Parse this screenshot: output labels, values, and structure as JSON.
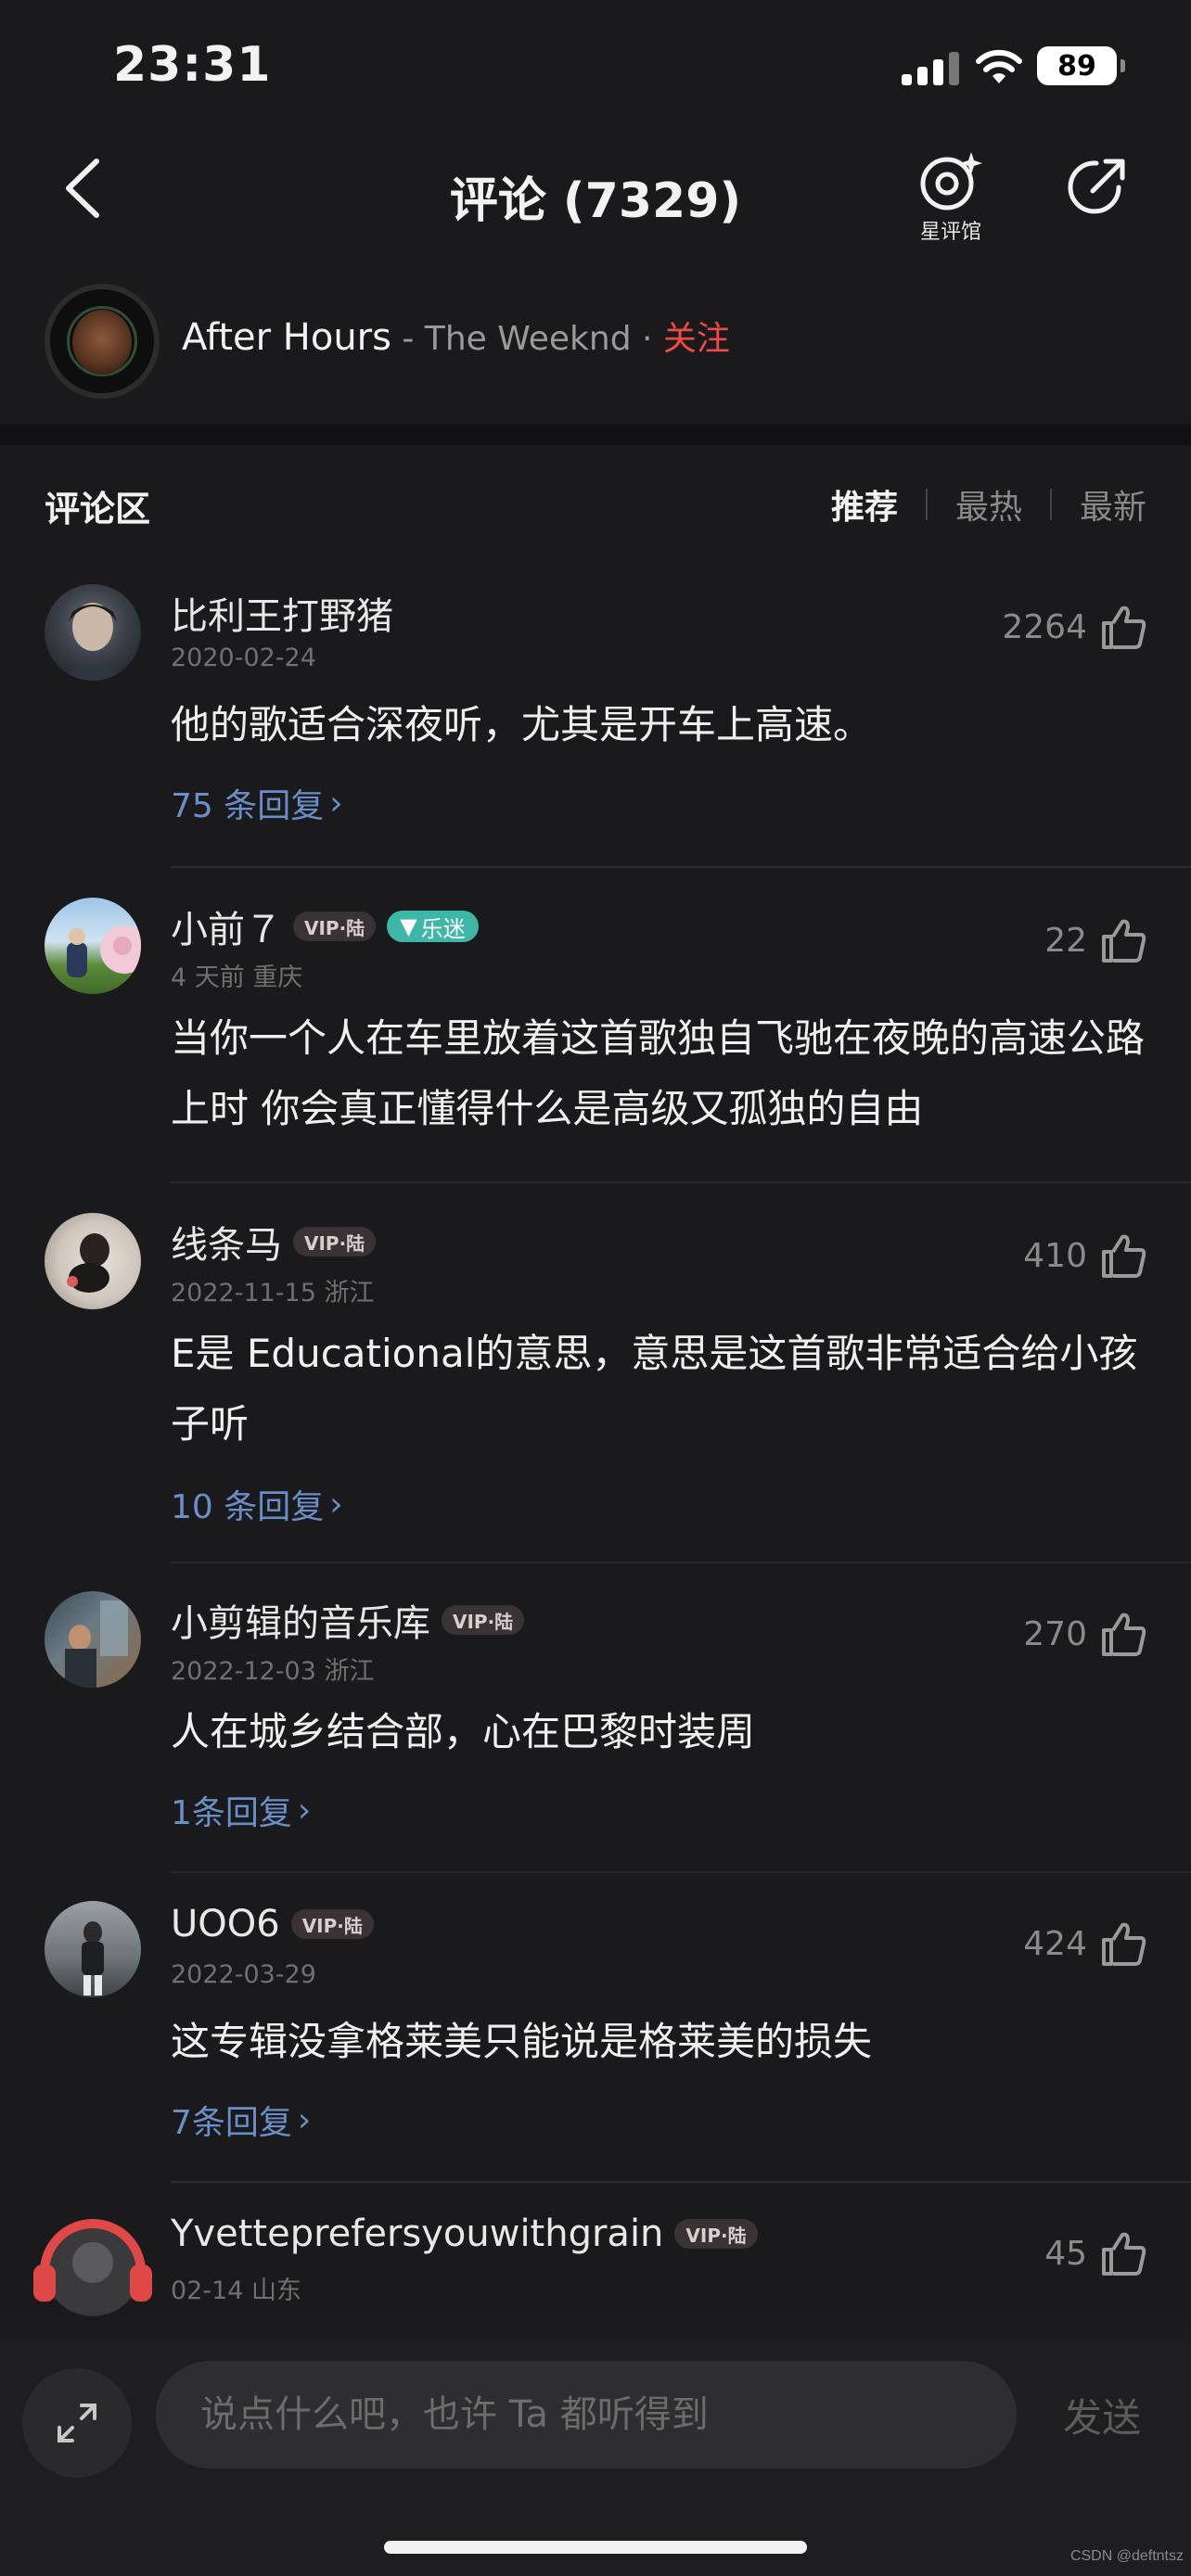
{
  "status_bar": {
    "time": "23:31",
    "battery": "89"
  },
  "header": {
    "title": "评论 (7329)",
    "star_label": "星评馆"
  },
  "song": {
    "title": "After Hours",
    "artist_sep": " - ",
    "artist": "The Weeknd",
    "dot": " · ",
    "follow": "关注"
  },
  "section": {
    "title": "评论区",
    "tabs": [
      "推荐",
      "最热",
      "最新"
    ],
    "active_tab": "推荐"
  },
  "comments": [
    {
      "username": "比利王打野猪",
      "meta": "2020-02-24",
      "likes": "2264",
      "text": "他的歌适合深夜听，尤其是开车上高速。",
      "replies": "75 条回复"
    },
    {
      "username": "小前７",
      "vip": "VIP·陆",
      "fan": "乐迷",
      "meta": "4 天前 重庆",
      "likes": "22",
      "text": "当你一个人在车里放着这首歌独自飞驰在夜晚的高速公路上时 你会真正懂得什么是高级又孤独的自由"
    },
    {
      "username": "线条马",
      "vip": "VIP·陆",
      "meta": "2022-11-15 浙江",
      "likes": "410",
      "text": "E是 Educational的意思，意思是这首歌非常适合给小孩子听",
      "replies": "10 条回复"
    },
    {
      "username": "小剪辑的音乐库",
      "vip": "VIP·陆",
      "meta": "2022-12-03 浙江",
      "likes": "270",
      "text": "人在城乡结合部，心在巴黎时装周",
      "replies": "1条回复"
    },
    {
      "username": "UOO6",
      "vip": "VIP·陆",
      "meta": "2022-03-29",
      "likes": "424",
      "text": "这专辑没拿格莱美只能说是格莱美的损失",
      "replies": "7条回复"
    },
    {
      "username": "Yvetteprefersyouwithgrain",
      "vip": "VIP·陆",
      "meta": "02-14 山东",
      "likes": "45"
    }
  ],
  "input": {
    "placeholder": "说点什么吧，也许 Ta 都听得到",
    "send": "发送"
  },
  "watermark": "CSDN @deftntsz",
  "colors": {
    "accent_red": "#ef4a44",
    "link_blue": "#6a8fc8",
    "fan_teal": "#3fb7a8",
    "background": "#1a1a1c"
  }
}
